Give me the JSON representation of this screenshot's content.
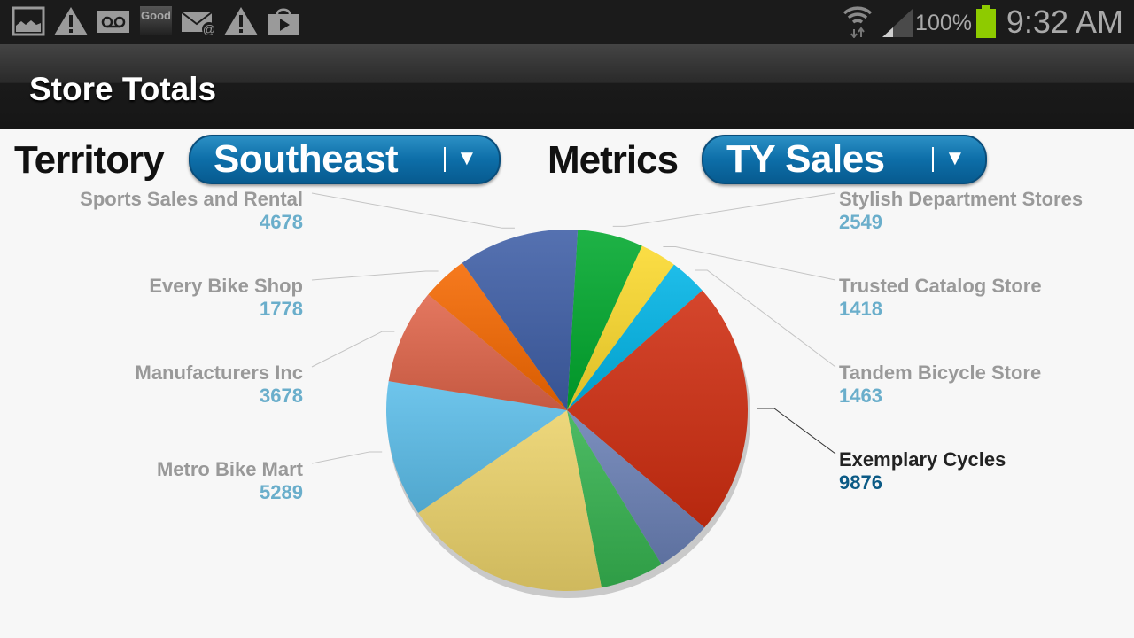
{
  "status_bar": {
    "left_icons": [
      "gallery-icon",
      "warning-icon",
      "voicemail-icon",
      "good-app-icon",
      "email-icon",
      "warning-icon",
      "play-store-icon"
    ],
    "good_label": "Good",
    "battery_percent": "100%",
    "time": "9:32 AM",
    "colors": {
      "battery": "#8ecb00"
    }
  },
  "action_bar": {
    "title": "Store Totals"
  },
  "filters": {
    "territory_label": "Territory",
    "territory_value": "Southeast",
    "metrics_label": "Metrics",
    "metrics_value": "TY Sales"
  },
  "chart_data": {
    "type": "pie",
    "title": "",
    "start_angle_deg": 3.4,
    "direction": "clockwise",
    "selected": "Exemplary Cycles",
    "slices": [
      {
        "name": "Stylish Department Stores",
        "value": 2549,
        "color": "#00a82d",
        "labeled": true,
        "side": "right"
      },
      {
        "name": "Trusted Catalog Store",
        "value": 1418,
        "color": "#fbd92c",
        "labeled": true,
        "side": "right"
      },
      {
        "name": "Tandem Bicycle Store",
        "value": 1463,
        "color": "#00b4e6",
        "labeled": true,
        "side": "right"
      },
      {
        "name": "Exemplary Cycles",
        "value": 9876,
        "color": "#cf2d10",
        "labeled": true,
        "side": "right"
      },
      {
        "name": "",
        "value": 2170,
        "color": "#6a80b5",
        "labeled": false,
        "estimated": true
      },
      {
        "name": "",
        "value": 2470,
        "color": "#35b24f",
        "labeled": false,
        "estimated": true
      },
      {
        "name": "",
        "value": 8000,
        "color": "#ebd26a",
        "labeled": false,
        "estimated": true
      },
      {
        "name": "Metro Bike Mart",
        "value": 5289,
        "color": "#5bbde9",
        "labeled": true,
        "side": "left"
      },
      {
        "name": "Manufacturers Inc",
        "value": 3678,
        "color": "#e0654a",
        "labeled": true,
        "side": "left"
      },
      {
        "name": "Every Bike Shop",
        "value": 1778,
        "color": "#f56800",
        "labeled": true,
        "side": "left"
      },
      {
        "name": "Sports Sales and Rental",
        "value": 4678,
        "color": "#3e5ea6",
        "labeled": true,
        "side": "left"
      }
    ],
    "label_colors": {
      "name": "#999999",
      "value": "#6aaecb",
      "selected_name": "#222222",
      "selected_value": "#0b5a85"
    }
  }
}
